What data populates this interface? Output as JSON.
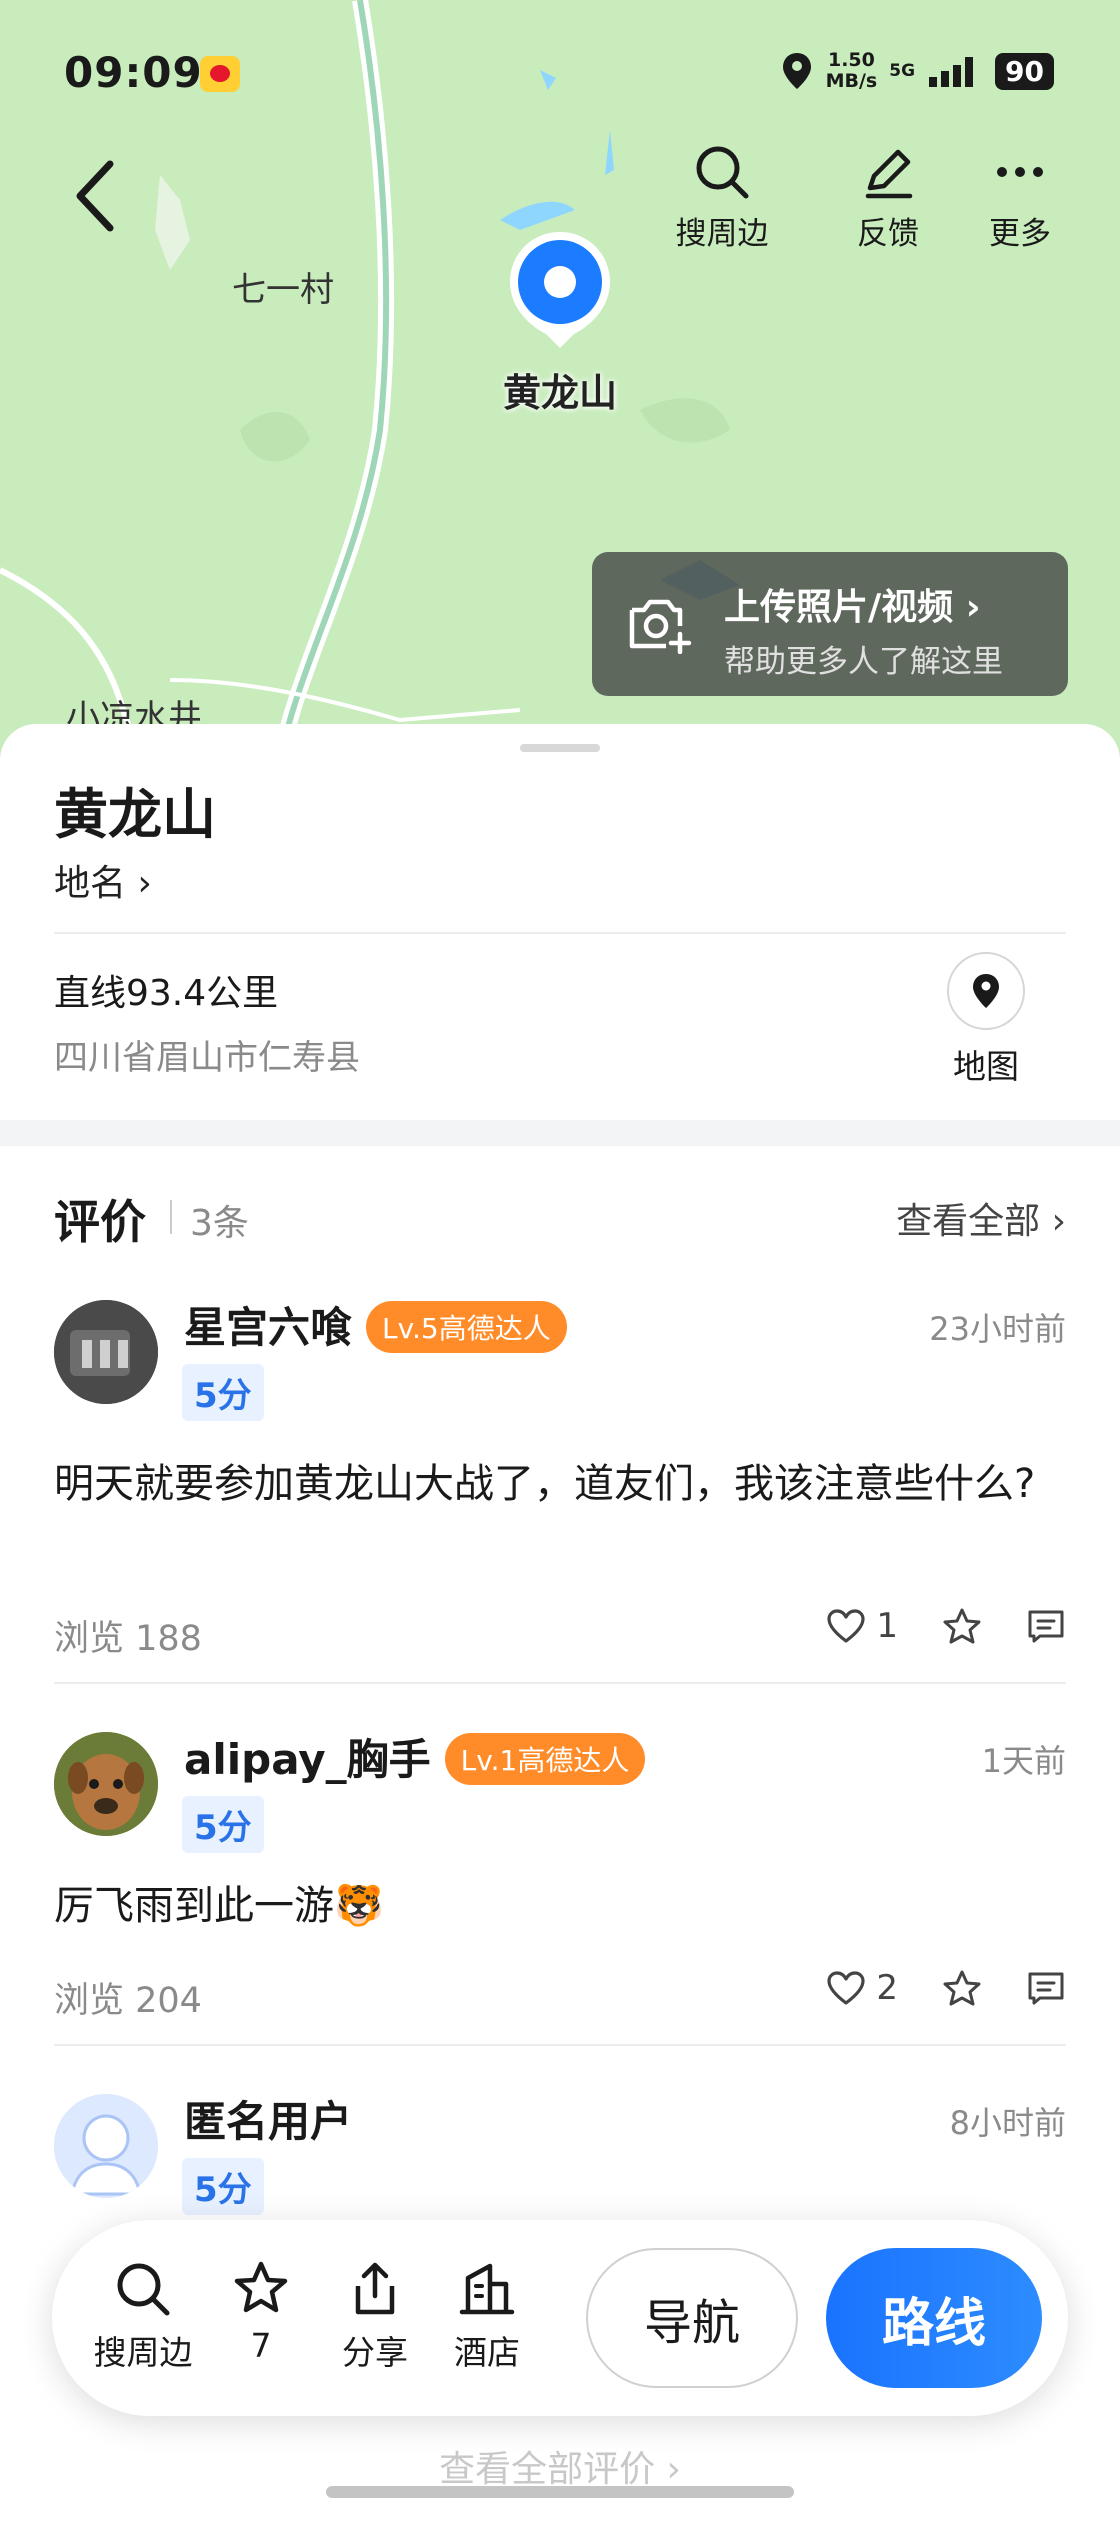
{
  "status_bar": {
    "time": "09:09",
    "speed_value": "1.50",
    "speed_unit": "MB/s",
    "network": "5G",
    "battery": "90"
  },
  "header": {
    "actions": [
      {
        "label": "搜周边",
        "icon": "search-icon"
      },
      {
        "label": "反馈",
        "icon": "edit-icon"
      },
      {
        "label": "更多",
        "icon": "more-icon"
      }
    ]
  },
  "map": {
    "labels": {
      "village1": "七一村",
      "village2": "小凉水井"
    },
    "pin_label": "黄龙山",
    "upload": {
      "title": "上传照片/视频",
      "subtitle": "帮助更多人了解这里"
    }
  },
  "place": {
    "name": "黄龙山",
    "type": "地名",
    "distance": "直线93.4公里",
    "address": "四川省眉山市仁寿县",
    "map_button": "地图"
  },
  "reviews": {
    "title": "评价",
    "count": "3条",
    "view_all": "查看全部",
    "items": [
      {
        "user": "星宫六喰",
        "badge": "Lv.5高德达人",
        "time": "23小时前",
        "score": "5分",
        "text": "明天就要参加黄龙山大战了，道友们，我该注意些什么?",
        "views": "浏览 188",
        "likes": "1"
      },
      {
        "user": "alipay_胸手",
        "badge": "Lv.1高德达人",
        "time": "1天前",
        "score": "5分",
        "text": "厉飞雨到此一游🐯",
        "views": "浏览 204",
        "likes": "2"
      },
      {
        "user": "匿名用户",
        "badge": "",
        "time": "8小时前",
        "score": "5分",
        "text": "",
        "views": "",
        "likes": ""
      }
    ],
    "view_all_bottom": "查看全部评价"
  },
  "bottom_bar": {
    "search": "搜周边",
    "favorite_count": "7",
    "share": "分享",
    "hotel": "酒店",
    "navigate": "导航",
    "route": "路线"
  },
  "colors": {
    "accent": "#2a72e8",
    "badge": "#ff8c28",
    "map_bg": "#c9ecbd",
    "route_button": "#1a73ff"
  }
}
